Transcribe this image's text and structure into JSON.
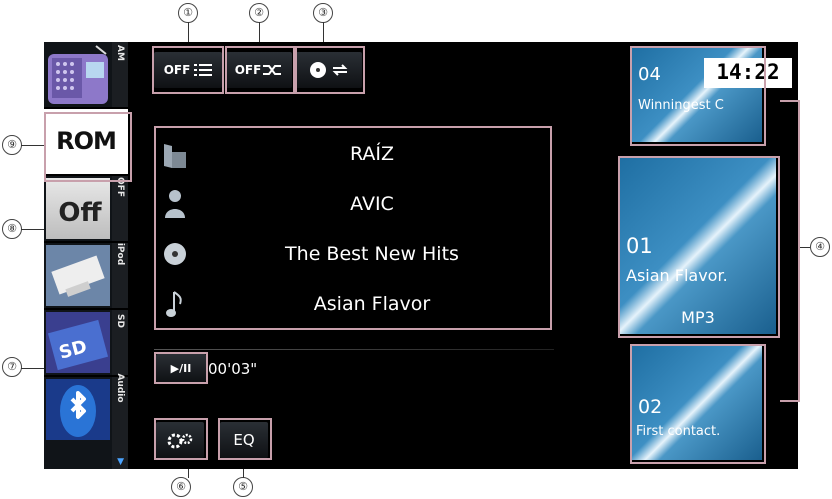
{
  "sources": [
    {
      "id": "am",
      "label": "AM"
    },
    {
      "id": "rom",
      "label": "ROM"
    },
    {
      "id": "off",
      "label": "OFF",
      "art_text": "Off"
    },
    {
      "id": "ipod",
      "label": "iPod"
    },
    {
      "id": "sd",
      "label": "SD"
    },
    {
      "id": "audio",
      "label": "Audio"
    }
  ],
  "toolbar": {
    "list_label": "OFF",
    "shuffle_label": "OFF",
    "play_pause_label": "▶/II",
    "eq_label": "EQ"
  },
  "track_info": {
    "folder": "RAÍZ",
    "artist": "AVIC",
    "album": "The Best New Hits",
    "title": "Asian Flavor"
  },
  "elapsed": "00'03\"",
  "clock": "14:22",
  "tiles": {
    "prev": {
      "number": "04",
      "name": "Winningest C"
    },
    "current": {
      "number": "01",
      "name": "Asian Flavor.",
      "format": "MP3"
    },
    "next": {
      "number": "02",
      "name": "First contact."
    }
  },
  "callout_numbers": [
    "①",
    "②",
    "③",
    "④",
    "⑤",
    "⑥",
    "⑦",
    "⑧",
    "⑨"
  ],
  "colors": {
    "callout": "#c8a0ac",
    "tile": "#2f84bb",
    "screen": "#000000"
  }
}
